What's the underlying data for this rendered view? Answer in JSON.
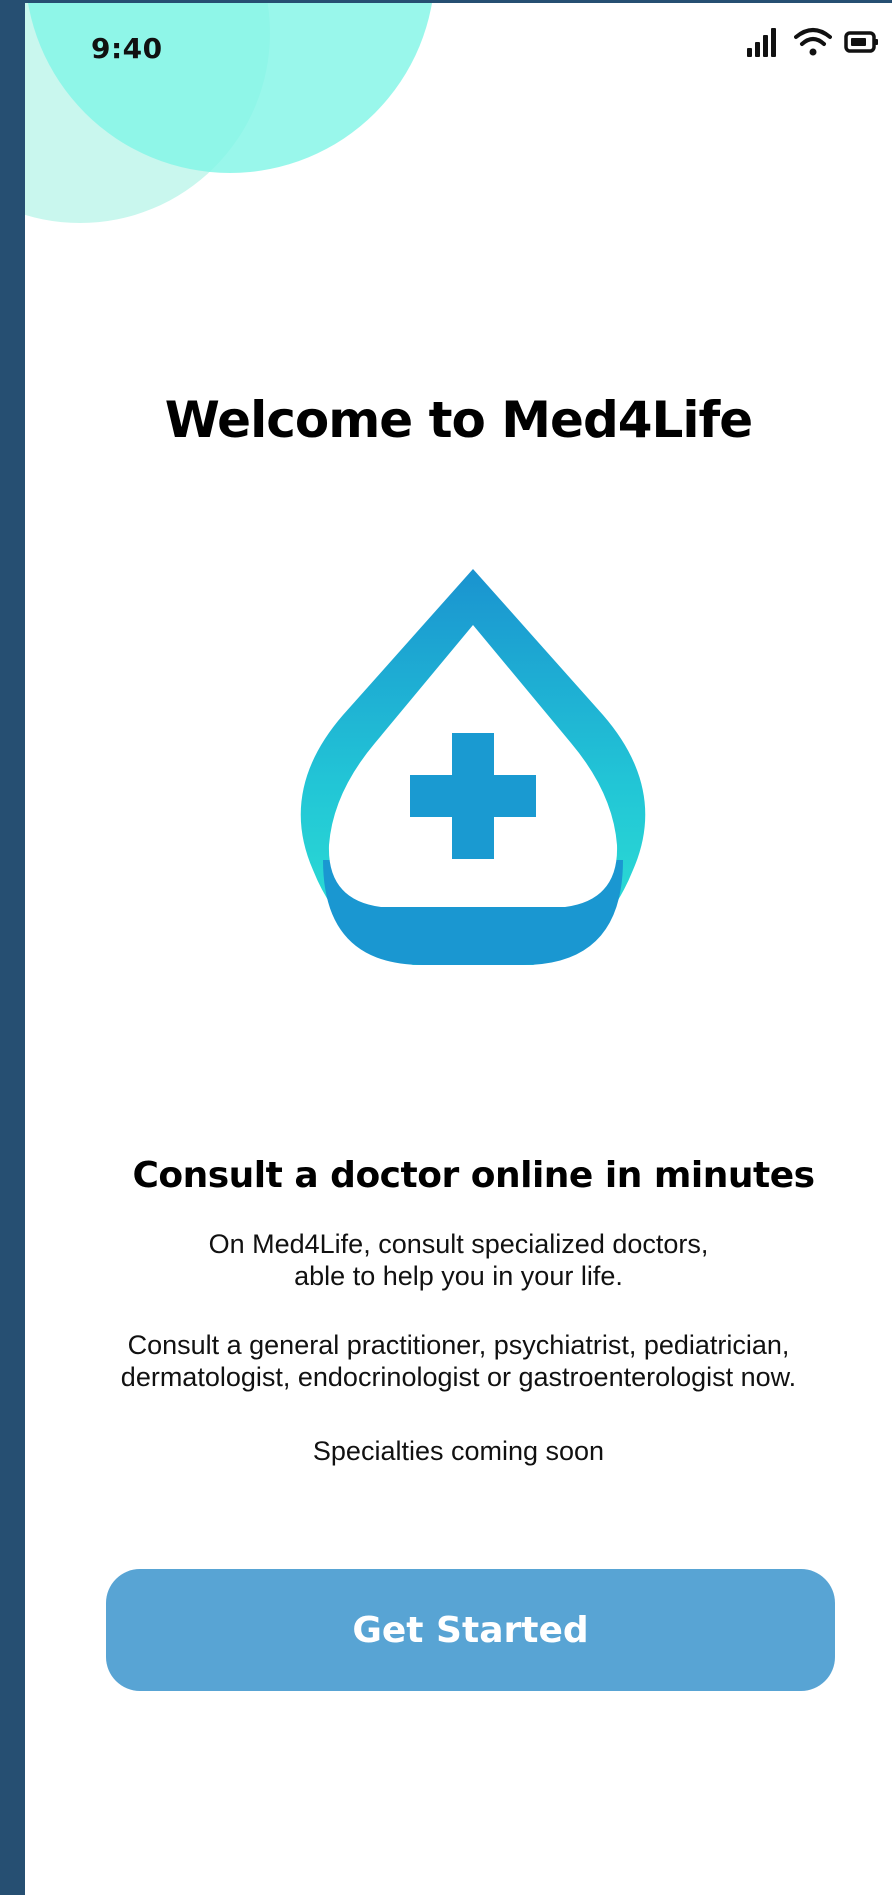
{
  "status_bar": {
    "time": "9:40",
    "icons": [
      "signal-icon",
      "wifi-icon",
      "battery-icon"
    ]
  },
  "welcome": {
    "title": "Welcome to Med4Life"
  },
  "logo": {
    "icon": "medical-drop-cross-logo",
    "colors": {
      "gradient_top": "#1a93d0",
      "gradient_bottom": "#2ee3d3",
      "base": "#1a97d1",
      "cross": "#1a9ad1"
    }
  },
  "info": {
    "headline": "Consult a doctor online in minutes",
    "paragraph1_line1": "On Med4Life, consult specialized doctors,",
    "paragraph1_line2": "able to help you in your life.",
    "paragraph2_line1": "Consult a general practitioner, psychiatrist, pediatrician,",
    "paragraph2_line2": "dermatologist, endocrinologist or gastroenterologist now.",
    "paragraph3": "Specialties coming soon"
  },
  "cta": {
    "label": "Get Started",
    "color": "#58a4d4"
  },
  "theme": {
    "outer_background": "#264f72",
    "bubble_light": "#c9f7ee",
    "bubble_mint": "#82f5e6"
  }
}
